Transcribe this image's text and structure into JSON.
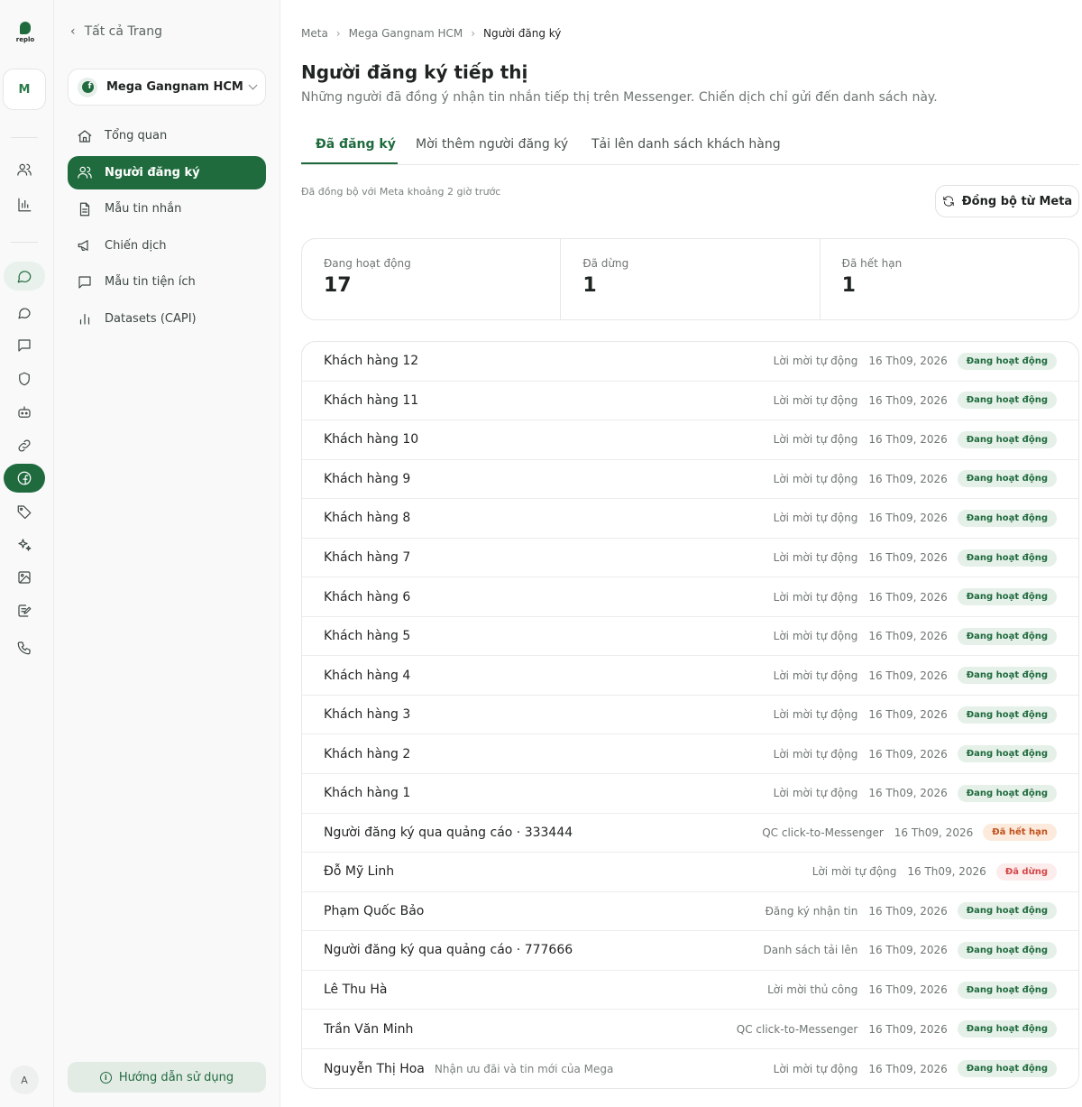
{
  "brand": {
    "logo_text": "replo",
    "workspace_initial": "M",
    "user_initial": "A"
  },
  "sidebar": {
    "back_label": "Tất cả Trang",
    "page_name": "Mega Gangnam HCM",
    "items": [
      {
        "label": "Tổng quan",
        "icon": "home-icon"
      },
      {
        "label": "Người đăng ký",
        "icon": "users-icon"
      },
      {
        "label": "Mẫu tin nhắn",
        "icon": "document-icon"
      },
      {
        "label": "Chiến dịch",
        "icon": "megaphone-icon"
      },
      {
        "label": "Mẫu tin tiện ích",
        "icon": "message-icon"
      },
      {
        "label": "Datasets (CAPI)",
        "icon": "bar-chart-icon"
      }
    ],
    "guide_label": "Hướng dẫn sử dụng"
  },
  "breadcrumb": [
    "Meta",
    "Mega Gangnam HCM",
    "Người đăng ký"
  ],
  "page": {
    "title": "Người đăng ký tiếp thị",
    "subtitle": "Những người đã đồng ý nhận tin nhắn tiếp thị trên Messenger. Chiến dịch chỉ gửi đến danh sách này."
  },
  "tabs": [
    "Đã đăng ký",
    "Mời thêm người đăng ký",
    "Tải lên danh sách khách hàng"
  ],
  "sync": {
    "note": "Đã đồng bộ với Meta khoảng 2 giờ trước",
    "button": "Đồng bộ từ Meta"
  },
  "stats": [
    {
      "label": "Đang hoạt động",
      "value": "17"
    },
    {
      "label": "Đã dừng",
      "value": "1"
    },
    {
      "label": "Đã hết hạn",
      "value": "1"
    }
  ],
  "subscribers": [
    {
      "name": "Khách hàng 12",
      "note": "",
      "source": "Lời mời tự động",
      "date": "16 Th09, 2026",
      "status": "Đang hoạt động",
      "kind": "active"
    },
    {
      "name": "Khách hàng 11",
      "note": "",
      "source": "Lời mời tự động",
      "date": "16 Th09, 2026",
      "status": "Đang hoạt động",
      "kind": "active"
    },
    {
      "name": "Khách hàng 10",
      "note": "",
      "source": "Lời mời tự động",
      "date": "16 Th09, 2026",
      "status": "Đang hoạt động",
      "kind": "active"
    },
    {
      "name": "Khách hàng 9",
      "note": "",
      "source": "Lời mời tự động",
      "date": "16 Th09, 2026",
      "status": "Đang hoạt động",
      "kind": "active"
    },
    {
      "name": "Khách hàng 8",
      "note": "",
      "source": "Lời mời tự động",
      "date": "16 Th09, 2026",
      "status": "Đang hoạt động",
      "kind": "active"
    },
    {
      "name": "Khách hàng 7",
      "note": "",
      "source": "Lời mời tự động",
      "date": "16 Th09, 2026",
      "status": "Đang hoạt động",
      "kind": "active"
    },
    {
      "name": "Khách hàng 6",
      "note": "",
      "source": "Lời mời tự động",
      "date": "16 Th09, 2026",
      "status": "Đang hoạt động",
      "kind": "active"
    },
    {
      "name": "Khách hàng 5",
      "note": "",
      "source": "Lời mời tự động",
      "date": "16 Th09, 2026",
      "status": "Đang hoạt động",
      "kind": "active"
    },
    {
      "name": "Khách hàng 4",
      "note": "",
      "source": "Lời mời tự động",
      "date": "16 Th09, 2026",
      "status": "Đang hoạt động",
      "kind": "active"
    },
    {
      "name": "Khách hàng 3",
      "note": "",
      "source": "Lời mời tự động",
      "date": "16 Th09, 2026",
      "status": "Đang hoạt động",
      "kind": "active"
    },
    {
      "name": "Khách hàng 2",
      "note": "",
      "source": "Lời mời tự động",
      "date": "16 Th09, 2026",
      "status": "Đang hoạt động",
      "kind": "active"
    },
    {
      "name": "Khách hàng 1",
      "note": "",
      "source": "Lời mời tự động",
      "date": "16 Th09, 2026",
      "status": "Đang hoạt động",
      "kind": "active"
    },
    {
      "name": "Người đăng ký qua quảng cáo · 333444",
      "note": "",
      "source": "QC click-to-Messenger",
      "date": "16 Th09, 2026",
      "status": "Đã hết hạn",
      "kind": "expired"
    },
    {
      "name": "Đỗ Mỹ Linh",
      "note": "",
      "source": "Lời mời tự động",
      "date": "16 Th09, 2026",
      "status": "Đã dừng",
      "kind": "stopped"
    },
    {
      "name": "Phạm Quốc Bảo",
      "note": "",
      "source": "Đăng ký nhận tin",
      "date": "16 Th09, 2026",
      "status": "Đang hoạt động",
      "kind": "active"
    },
    {
      "name": "Người đăng ký qua quảng cáo · 777666",
      "note": "",
      "source": "Danh sách tải lên",
      "date": "16 Th09, 2026",
      "status": "Đang hoạt động",
      "kind": "active"
    },
    {
      "name": "Lê Thu Hà",
      "note": "",
      "source": "Lời mời thủ công",
      "date": "16 Th09, 2026",
      "status": "Đang hoạt động",
      "kind": "active"
    },
    {
      "name": "Trần Văn Minh",
      "note": "",
      "source": "QC click-to-Messenger",
      "date": "16 Th09, 2026",
      "status": "Đang hoạt động",
      "kind": "active"
    },
    {
      "name": "Nguyễn Thị Hoa",
      "note": "Nhận ưu đãi và tin mới của Mega",
      "source": "Lời mời tự động",
      "date": "16 Th09, 2026",
      "status": "Đang hoạt động",
      "kind": "active"
    }
  ],
  "colors": {
    "accent": "#1f6b3e",
    "active_badge_bg": "#e5f0e8",
    "expired": "#c2501c",
    "stopped": "#d44747"
  }
}
